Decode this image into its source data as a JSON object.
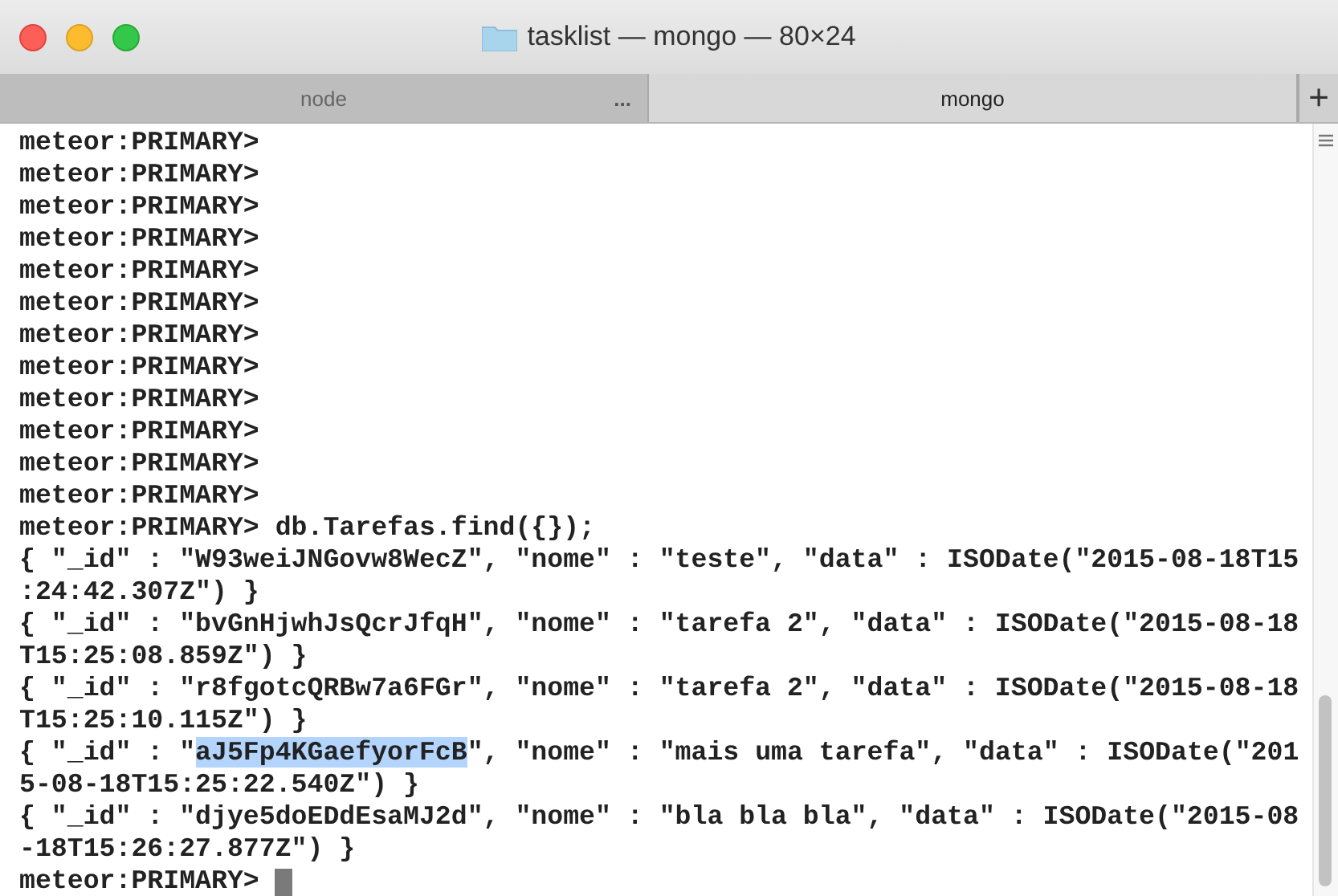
{
  "window": {
    "title": "tasklist — mongo — 80×24"
  },
  "tabs": [
    {
      "label": "node",
      "selected": false,
      "more": "..."
    },
    {
      "label": "mongo",
      "selected": true
    }
  ],
  "new_tab": "+",
  "terminal": {
    "lines": [
      {
        "text": "meteor:PRIMARY>"
      },
      {
        "text": "meteor:PRIMARY>"
      },
      {
        "text": "meteor:PRIMARY>"
      },
      {
        "text": "meteor:PRIMARY>"
      },
      {
        "text": "meteor:PRIMARY>"
      },
      {
        "text": "meteor:PRIMARY>"
      },
      {
        "text": "meteor:PRIMARY>"
      },
      {
        "text": "meteor:PRIMARY>"
      },
      {
        "text": "meteor:PRIMARY>"
      },
      {
        "text": "meteor:PRIMARY>"
      },
      {
        "text": "meteor:PRIMARY>"
      },
      {
        "text": "meteor:PRIMARY>"
      },
      {
        "text": "meteor:PRIMARY> db.Tarefas.find({});"
      },
      {
        "text": "{ \"_id\" : \"W93weiJNGovw8WecZ\", \"nome\" : \"teste\", \"data\" : ISODate(\"2015-08-18T15"
      },
      {
        "text": ":24:42.307Z\") }"
      },
      {
        "text": "{ \"_id\" : \"bvGnHjwhJsQcrJfqH\", \"nome\" : \"tarefa 2\", \"data\" : ISODate(\"2015-08-18"
      },
      {
        "text": "T15:25:08.859Z\") }"
      },
      {
        "text": "{ \"_id\" : \"r8fgotcQRBw7a6FGr\", \"nome\" : \"tarefa 2\", \"data\" : ISODate(\"2015-08-18"
      },
      {
        "text": "T15:25:10.115Z\") }"
      },
      {
        "segments": [
          {
            "text": "{ \"_id\" : \"",
            "selected": false
          },
          {
            "text": "aJ5Fp4KGaefyorFcB",
            "selected": true
          },
          {
            "text": "\", \"nome\" : \"mais uma tarefa\", \"data\" : ISODate(\"201",
            "selected": false
          }
        ]
      },
      {
        "text": "5-08-18T15:25:22.540Z\") }"
      },
      {
        "text": "{ \"_id\" : \"djye5doEDdEsaMJ2d\", \"nome\" : \"bla bla bla\", \"data\" : ISODate(\"2015-08"
      },
      {
        "text": "-18T15:26:27.877Z\") }"
      }
    ],
    "prompt": {
      "text": "meteor:PRIMARY>",
      "cursor": true
    }
  }
}
